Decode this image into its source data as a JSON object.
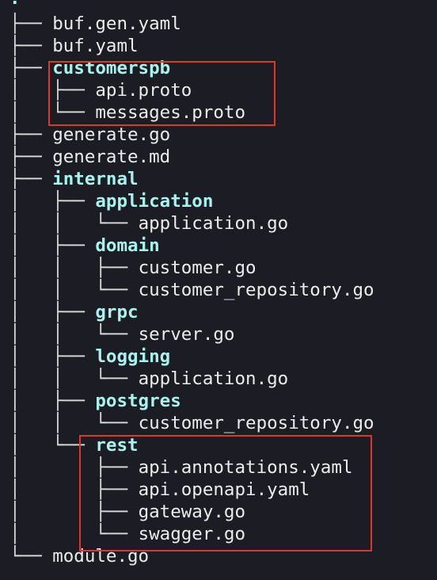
{
  "tree": {
    "root": ".",
    "lines": [
      {
        "prefix": "├── ",
        "name": "buf.gen.yaml",
        "kind": "file"
      },
      {
        "prefix": "├── ",
        "name": "buf.yaml",
        "kind": "file"
      },
      {
        "prefix": "├── ",
        "name": "customerspb",
        "kind": "dir"
      },
      {
        "prefix": "│   ├── ",
        "name": "api.proto",
        "kind": "file"
      },
      {
        "prefix": "│   └── ",
        "name": "messages.proto",
        "kind": "file"
      },
      {
        "prefix": "├── ",
        "name": "generate.go",
        "kind": "file"
      },
      {
        "prefix": "├── ",
        "name": "generate.md",
        "kind": "file"
      },
      {
        "prefix": "├── ",
        "name": "internal",
        "kind": "dir"
      },
      {
        "prefix": "│   ├── ",
        "name": "application",
        "kind": "dir"
      },
      {
        "prefix": "│   │   └── ",
        "name": "application.go",
        "kind": "file"
      },
      {
        "prefix": "│   ├── ",
        "name": "domain",
        "kind": "dir"
      },
      {
        "prefix": "│   │   ├── ",
        "name": "customer.go",
        "kind": "file"
      },
      {
        "prefix": "│   │   └── ",
        "name": "customer_repository.go",
        "kind": "file"
      },
      {
        "prefix": "│   ├── ",
        "name": "grpc",
        "kind": "dir"
      },
      {
        "prefix": "│   │   └── ",
        "name": "server.go",
        "kind": "file"
      },
      {
        "prefix": "│   ├── ",
        "name": "logging",
        "kind": "dir"
      },
      {
        "prefix": "│   │   └── ",
        "name": "application.go",
        "kind": "file"
      },
      {
        "prefix": "│   ├── ",
        "name": "postgres",
        "kind": "dir"
      },
      {
        "prefix": "│   │   └── ",
        "name": "customer_repository.go",
        "kind": "file"
      },
      {
        "prefix": "│   └── ",
        "name": "rest",
        "kind": "dir"
      },
      {
        "prefix": "│       ├── ",
        "name": "api.annotations.yaml",
        "kind": "file"
      },
      {
        "prefix": "│       ├── ",
        "name": "api.openapi.yaml",
        "kind": "file"
      },
      {
        "prefix": "│       ├── ",
        "name": "gateway.go",
        "kind": "file"
      },
      {
        "prefix": "│       └── ",
        "name": "swagger.go",
        "kind": "file"
      },
      {
        "prefix": "└── ",
        "name": "module.go",
        "kind": "file"
      }
    ]
  },
  "colors": {
    "background": "#1c1d24",
    "directory": "#a7f3ee",
    "file": "#ececec",
    "highlight": "#e0352b"
  }
}
